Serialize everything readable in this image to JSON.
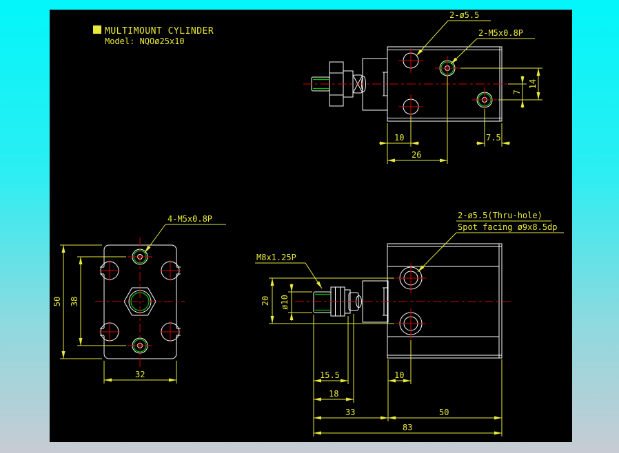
{
  "window": {
    "frame_top_color": "#02f6fa",
    "frame_bottom_color": "#c7cbd3",
    "canvas_color": "#000000"
  },
  "colors": {
    "geometry": "#ffffff",
    "centerline": "#d40000",
    "thread": "#00c400",
    "dimension": "#e9e93d"
  },
  "title_block": {
    "title": "MULTIMOUNT  CYLINDER",
    "model": "Model: NQOø25x10"
  },
  "top_view": {
    "labels": {
      "thru_holes": "2-ø5.5",
      "tapped_holes": "2-M5x0.8P"
    },
    "dims": {
      "d10": "10",
      "d26": "26",
      "d75": "7.5",
      "d7": "7",
      "d14": "14"
    }
  },
  "front_view": {
    "labels": {
      "tapped_holes": "4-M5x0.8P"
    },
    "dims": {
      "d50": "50",
      "d38": "38",
      "d32": "32"
    }
  },
  "side_view": {
    "labels": {
      "rod_thread": "M8x1.25P",
      "thru_line1": "2-ø5.5(Thru-hole)",
      "thru_line2": "Spot facing ø9x8.5dp"
    },
    "dims": {
      "d20": "20",
      "dia10": "ø10",
      "d155": "15.5",
      "d18": "18",
      "d10": "10",
      "d33": "33",
      "d50": "50",
      "d83": "83"
    }
  }
}
